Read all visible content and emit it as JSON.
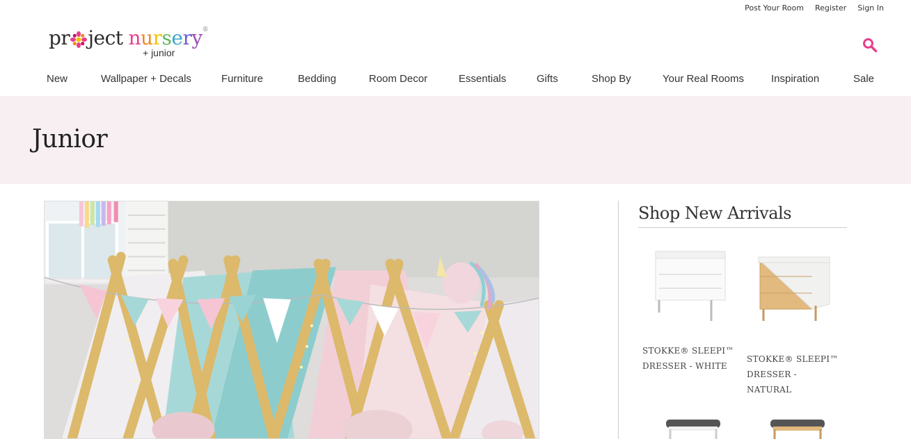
{
  "utility_links": [
    "Post Your Room",
    "Register",
    "Sign In"
  ],
  "logo": {
    "pr": "pr",
    "ject": "ject",
    "nursery_letters": [
      "n",
      "u",
      "r",
      "s",
      "e",
      "r",
      "y"
    ],
    "nursery_colors": [
      "#e83e8c",
      "#f08a24",
      "#f2c200",
      "#5bb85d",
      "#3aa8c9",
      "#6d5bd0",
      "#9b4fb3"
    ],
    "junior": "+ junior",
    "reg": "®"
  },
  "icons": {
    "search": "search-icon",
    "logo_flower": "flower-icon"
  },
  "accent_color": "#e83e8c",
  "nav": {
    "items": [
      "New",
      "Wallpaper + Decals",
      "Furniture",
      "Bedding",
      "Room Decor",
      "Essentials",
      "Gifts",
      "Shop By",
      "Your Real Rooms",
      "Inspiration",
      "Sale"
    ]
  },
  "banner": {
    "title": "Junior"
  },
  "sidebar": {
    "title": "Shop New Arrivals",
    "products": [
      {
        "name": "STOKKE® SLEEPI™\nDRESSER - WHITE"
      },
      {
        "name": "STOKKE® SLEEPI™\nDRESSER - NATURAL"
      },
      {
        "name": ""
      },
      {
        "name": ""
      }
    ]
  }
}
